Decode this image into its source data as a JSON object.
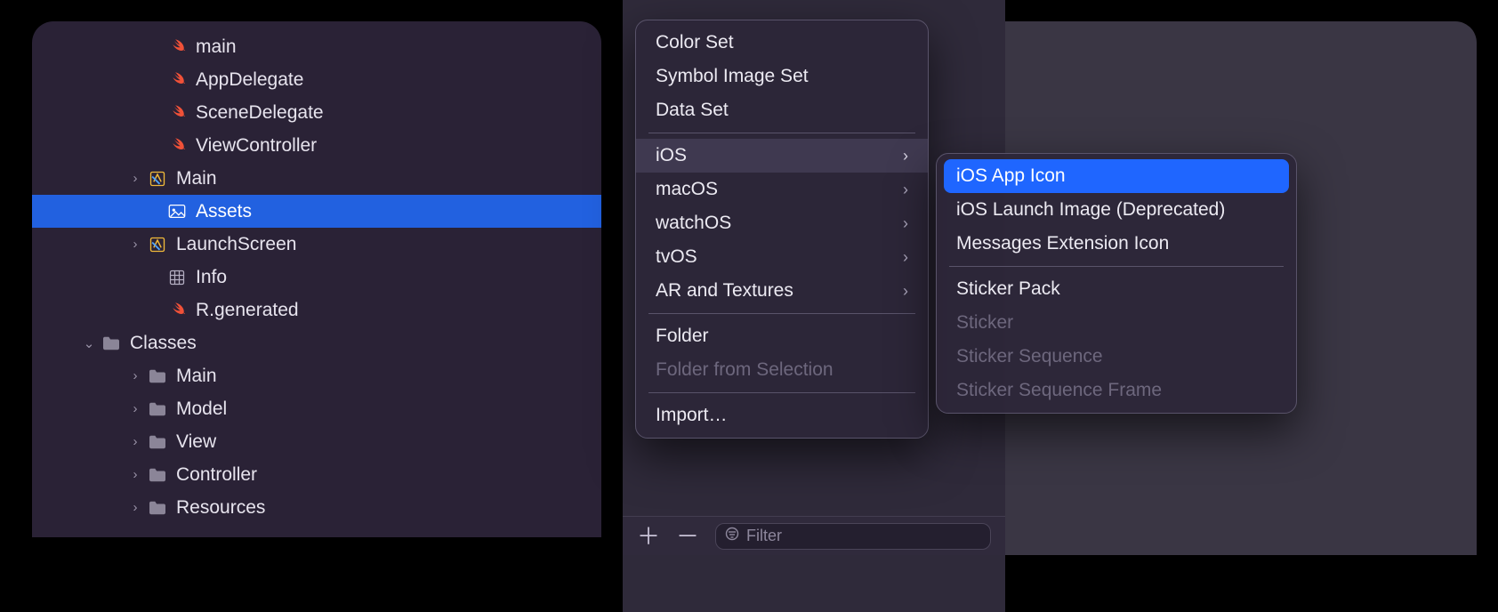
{
  "navigator": {
    "items": [
      {
        "icon": "swift",
        "label": "main",
        "indent": 130,
        "disclosure": ""
      },
      {
        "icon": "swift",
        "label": "AppDelegate",
        "indent": 130,
        "disclosure": ""
      },
      {
        "icon": "swift",
        "label": "SceneDelegate",
        "indent": 130,
        "disclosure": ""
      },
      {
        "icon": "swift",
        "label": "ViewController",
        "indent": 130,
        "disclosure": ""
      },
      {
        "icon": "xcode",
        "label": "Main",
        "indent": 108,
        "disclosure": "›"
      },
      {
        "icon": "assets",
        "label": "Assets",
        "indent": 130,
        "disclosure": "",
        "selected": true
      },
      {
        "icon": "xcode",
        "label": "LaunchScreen",
        "indent": 108,
        "disclosure": "›"
      },
      {
        "icon": "plist",
        "label": "Info",
        "indent": 130,
        "disclosure": ""
      },
      {
        "icon": "swift",
        "label": "R.generated",
        "indent": 130,
        "disclosure": ""
      },
      {
        "icon": "folder",
        "label": "Classes",
        "indent": 56,
        "disclosure": "⌄"
      },
      {
        "icon": "folder",
        "label": "Main",
        "indent": 108,
        "disclosure": "›"
      },
      {
        "icon": "folder",
        "label": "Model",
        "indent": 108,
        "disclosure": "›"
      },
      {
        "icon": "folder",
        "label": "View",
        "indent": 108,
        "disclosure": "›"
      },
      {
        "icon": "folder",
        "label": "Controller",
        "indent": 108,
        "disclosure": "›"
      },
      {
        "icon": "folder",
        "label": "Resources",
        "indent": 108,
        "disclosure": "›"
      }
    ]
  },
  "context_menu": {
    "items": [
      {
        "label": "Color Set"
      },
      {
        "label": "Symbol Image Set"
      },
      {
        "label": "Data Set"
      },
      {
        "sep": true
      },
      {
        "label": "iOS",
        "submenu": true,
        "hover": true
      },
      {
        "label": "macOS",
        "submenu": true
      },
      {
        "label": "watchOS",
        "submenu": true
      },
      {
        "label": "tvOS",
        "submenu": true
      },
      {
        "label": "AR and Textures",
        "submenu": true
      },
      {
        "sep": true
      },
      {
        "label": "Folder"
      },
      {
        "label": "Folder from Selection",
        "disabled": true
      },
      {
        "sep": true
      },
      {
        "label": "Import…"
      }
    ]
  },
  "submenu": {
    "items": [
      {
        "label": "iOS App Icon",
        "selected": true
      },
      {
        "label": "iOS Launch Image (Deprecated)"
      },
      {
        "label": "Messages Extension Icon"
      },
      {
        "sep": true
      },
      {
        "label": "Sticker Pack"
      },
      {
        "label": "Sticker",
        "disabled": true
      },
      {
        "label": "Sticker Sequence",
        "disabled": true
      },
      {
        "label": "Sticker Sequence Frame",
        "disabled": true
      }
    ]
  },
  "toolbar": {
    "add": "＋",
    "remove": "－",
    "filter_placeholder": "Filter"
  }
}
